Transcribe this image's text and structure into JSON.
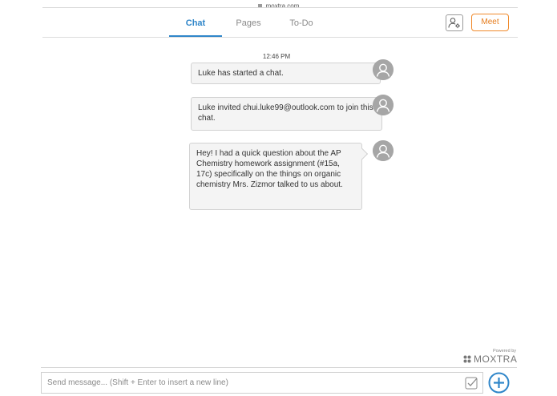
{
  "browser": {
    "url": "moxtra.com"
  },
  "tabs": [
    {
      "label": "Chat",
      "active": true
    },
    {
      "label": "Pages",
      "active": false
    },
    {
      "label": "To-Do",
      "active": false
    }
  ],
  "header": {
    "meet_label": "Meet",
    "participants_icon": "user-settings-icon"
  },
  "chat": {
    "timestamp": "12:46 PM",
    "messages": [
      {
        "text": "Luke has started a chat."
      },
      {
        "text": "Luke invited chui.luke99@outlook.com to join this chat."
      },
      {
        "text": "Hey! I had a quick question about the AP Chemistry homework assignment (#15a, 17c) specifically on the things on organic chemistry Mrs. Zizmor talked to us about."
      }
    ]
  },
  "branding": {
    "powered_by": "Powered by",
    "name": "MOXTRA"
  },
  "composer": {
    "placeholder": "Send message... (Shift + Enter to insert a new line)",
    "value": ""
  },
  "colors": {
    "accent": "#2f86c9",
    "meet": "#f08a2c"
  }
}
